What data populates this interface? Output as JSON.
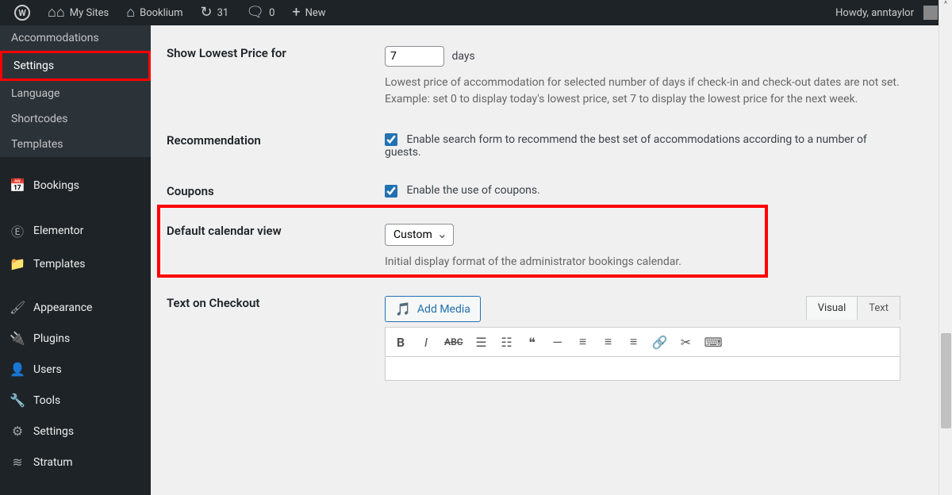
{
  "adminbar": {
    "mysites": "My Sites",
    "sitename": "Booklium",
    "updates": "31",
    "comments": "0",
    "new": "New",
    "howdy": "Howdy, anntaylor"
  },
  "sidebar": {
    "submenu": [
      "Accommodations",
      "Settings",
      "Language",
      "Shortcodes",
      "Templates"
    ],
    "current_submenu": 1,
    "menu": [
      {
        "icon": "calendar",
        "label": "Bookings"
      },
      {
        "icon": "elementor",
        "label": "Elementor"
      },
      {
        "icon": "folder",
        "label": "Templates"
      },
      {
        "icon": "brush",
        "label": "Appearance"
      },
      {
        "icon": "plug",
        "label": "Plugins"
      },
      {
        "icon": "user",
        "label": "Users"
      },
      {
        "icon": "wrench",
        "label": "Tools"
      },
      {
        "icon": "sliders",
        "label": "Settings"
      },
      {
        "icon": "stratum",
        "label": "Stratum"
      }
    ]
  },
  "settings": {
    "lowest_price": {
      "label": "Show Lowest Price for",
      "value": "7",
      "unit": "days",
      "desc": "Lowest price of accommodation for selected number of days if check-in and check-out dates are not set. Example: set 0 to display today's lowest price, set 7 to display the lowest price for the next week."
    },
    "recommendation": {
      "label": "Recommendation",
      "checked": true,
      "text": "Enable search form to recommend the best set of accommodations according to a number of guests."
    },
    "coupons": {
      "label": "Coupons",
      "checked": true,
      "text": "Enable the use of coupons."
    },
    "calendar_view": {
      "label": "Default calendar view",
      "value": "Custom",
      "desc": "Initial display format of the administrator bookings calendar."
    },
    "checkout_text": {
      "label": "Text on Checkout",
      "add_media": "Add Media",
      "tab_visual": "Visual",
      "tab_text": "Text"
    }
  }
}
